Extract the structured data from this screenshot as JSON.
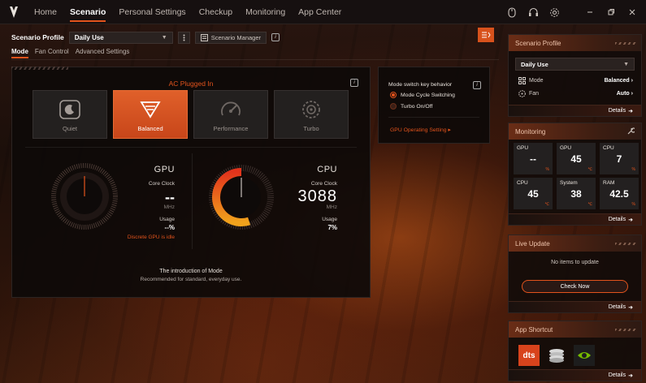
{
  "nav": {
    "items": [
      "Home",
      "Scenario",
      "Personal Settings",
      "Checkup",
      "Monitoring",
      "App Center"
    ],
    "active_index": 1
  },
  "profile": {
    "label": "Scenario Profile",
    "selected": "Daily Use",
    "manager_label": "Scenario Manager"
  },
  "subtabs": {
    "items": [
      "Mode",
      "Fan Control",
      "Advanced Settings"
    ],
    "active_index": 0
  },
  "mode": {
    "power_status": "AC Plugged In",
    "modes": [
      {
        "label": "Quiet",
        "icon": "quiet-mode-icon"
      },
      {
        "label": "Balanced",
        "icon": "balanced-mode-icon"
      },
      {
        "label": "Performance",
        "icon": "performance-mode-icon"
      },
      {
        "label": "Turbo",
        "icon": "turbo-mode-icon"
      }
    ],
    "active_mode": "Balanced",
    "gpu": {
      "title": "GPU",
      "clock_label": "Core Clock",
      "clock_value": "--",
      "clock_unit": "MHz",
      "usage_label": "Usage",
      "usage_value": "--%",
      "note": "Discrete GPU is idle"
    },
    "cpu": {
      "title": "CPU",
      "clock_label": "Core Clock",
      "clock_value": "3088",
      "clock_unit": "MHz",
      "usage_label": "Usage",
      "usage_value": "7%",
      "gauge_level": 0.55
    },
    "intro_title": "The introduction of Mode",
    "intro_desc": "Recommended for standard, everyday use."
  },
  "switch_behavior": {
    "title": "Mode switch key behavior",
    "options": [
      "Mode Cycle Switching",
      "Turbo On/Off"
    ],
    "selected_index": 0,
    "gpu_link": "GPU Operating Setting ▸"
  },
  "side": {
    "scenario_profile": {
      "title": "Scenario Profile",
      "selected": "Daily Use",
      "rows": [
        {
          "label": "Mode",
          "value": "Balanced"
        },
        {
          "label": "Fan",
          "value": "Auto"
        }
      ],
      "details": "Details"
    },
    "monitoring": {
      "title": "Monitoring",
      "cells": [
        {
          "k": "GPU",
          "v": "--",
          "u": "%"
        },
        {
          "k": "GPU",
          "v": "45",
          "u": "℃"
        },
        {
          "k": "CPU",
          "v": "7",
          "u": "%"
        },
        {
          "k": "CPU",
          "v": "45",
          "u": "℃"
        },
        {
          "k": "System",
          "v": "38",
          "u": "℃"
        },
        {
          "k": "RAM",
          "v": "42.5",
          "u": "%"
        }
      ],
      "details": "Details"
    },
    "live_update": {
      "title": "Live Update",
      "empty_text": "No items to update",
      "button": "Check Now",
      "details": "Details"
    },
    "app_shortcut": {
      "title": "App Shortcut",
      "apps": [
        "dts-app-icon",
        "coin-stack-app-icon",
        "nvidia-app-icon"
      ],
      "dts_text": "dts",
      "details": "Details"
    }
  },
  "colors": {
    "accent": "#e2531c",
    "panel": "#0e0a09",
    "active_card": "#d8521c"
  }
}
